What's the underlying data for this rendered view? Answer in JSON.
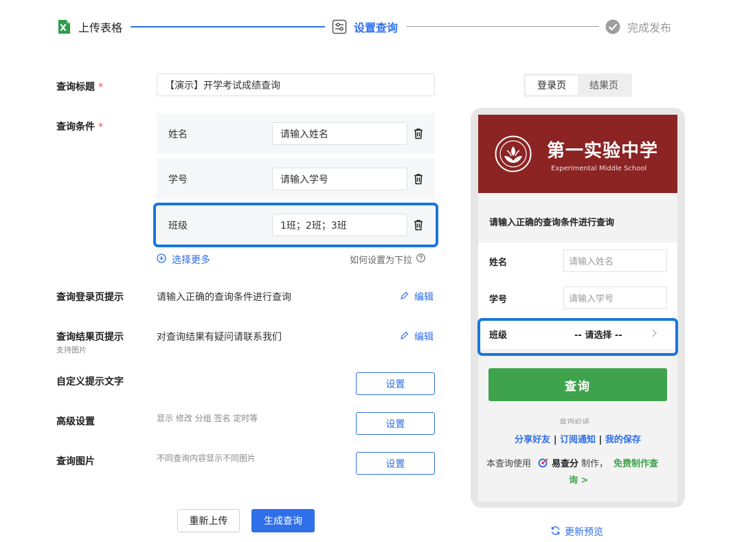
{
  "colors": {
    "accent": "#2f6fe8",
    "highlight_border": "#1677e0",
    "step_done_icon": "#2e9c4c",
    "required_mark": "#e5484d",
    "banner_bg": "#8b2423",
    "query_button_bg": "#3fa34d"
  },
  "steps": [
    {
      "label": "上传表格",
      "icon": "excel-icon",
      "state": "done"
    },
    {
      "label": "设置查询",
      "icon": "settings-sliders-icon",
      "state": "active"
    },
    {
      "label": "完成发布",
      "icon": "check-circle-icon",
      "state": "pending"
    }
  ],
  "form": {
    "title": {
      "label": "查询标题",
      "required": "*",
      "value": "【演示】开学考试成绩查询"
    },
    "conditions": {
      "label": "查询条件",
      "required": "*",
      "rows": [
        {
          "name": "姓名",
          "placeholder": "请输入姓名"
        },
        {
          "name": "学号",
          "placeholder": "请输入学号"
        },
        {
          "name": "班级",
          "value": "1班；2班；3班"
        }
      ],
      "add_more": "选择更多",
      "dropdown_help": "如何设置为下拉"
    },
    "login_hint": {
      "label": "查询登录页提示",
      "value": "请输入正确的查询条件进行查询",
      "edit": "编辑"
    },
    "result_hint": {
      "label": "查询结果页提示",
      "sublabel": "支持图片",
      "value": "对查询结果有疑问请联系我们",
      "edit": "编辑"
    },
    "custom_text": {
      "label": "自定义提示文字",
      "button": "设置"
    },
    "advanced": {
      "label": "高级设置",
      "hint": "显示 修改 分组 签名 定时等",
      "button": "设置"
    },
    "image": {
      "label": "查询图片",
      "hint": "不同查询内容显示不同图片",
      "button": "设置"
    }
  },
  "actions": {
    "reupload": "重新上传",
    "generate": "生成查询"
  },
  "preview": {
    "tabs": [
      "登录页",
      "结果页"
    ],
    "active_tab": "登录页",
    "school_name": "第一实验中学",
    "school_name_en": "Experimental Middle School",
    "prompt": "请输入正确的查询条件进行查询",
    "fields": [
      {
        "label": "姓名",
        "placeholder": "请输入姓名"
      },
      {
        "label": "学号",
        "placeholder": "请输入学号"
      },
      {
        "label": "班级",
        "select": "-- 请选择 --"
      }
    ],
    "query_button": "查询",
    "cutoff_text": "查询必读",
    "links": {
      "share": "分享好友",
      "sep": "|",
      "subscribe": "订阅通知",
      "saved": "我的保存"
    },
    "made_by": {
      "prefix": "本查询使用",
      "brand": "易查分",
      "suffix": "制作，",
      "free_a": "免费制作查",
      "free_b": "询 >"
    },
    "refresh": "更新预览"
  }
}
